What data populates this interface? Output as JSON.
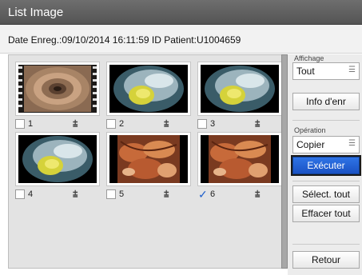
{
  "window": {
    "title": "List Image"
  },
  "info": {
    "text": "Date Enreg.:09/10/2014 16:11:59  ID Patient:U1004659"
  },
  "sidebar": {
    "affichage_label": "Affichage",
    "display_value": "Tout",
    "info_button": "Info d'enr",
    "operation_label": "Opération",
    "operation_value": "Copier",
    "execute_button": "Exécuter",
    "select_all_button": "Sélect. tout",
    "clear_all_button": "Effacer tout",
    "back_button": "Retour"
  },
  "thumbnails": [
    {
      "number": "1",
      "checked": false,
      "type": "endoscopy-film"
    },
    {
      "number": "2",
      "checked": false,
      "type": "colon-yellow"
    },
    {
      "number": "3",
      "checked": false,
      "type": "colon-yellow"
    },
    {
      "number": "4",
      "checked": false,
      "type": "colon-yellow"
    },
    {
      "number": "5",
      "checked": false,
      "type": "surgery"
    },
    {
      "number": "6",
      "checked": true,
      "type": "surgery"
    }
  ],
  "icons": {
    "annotation": "annotation-icon",
    "dropdown": "list-icon"
  }
}
